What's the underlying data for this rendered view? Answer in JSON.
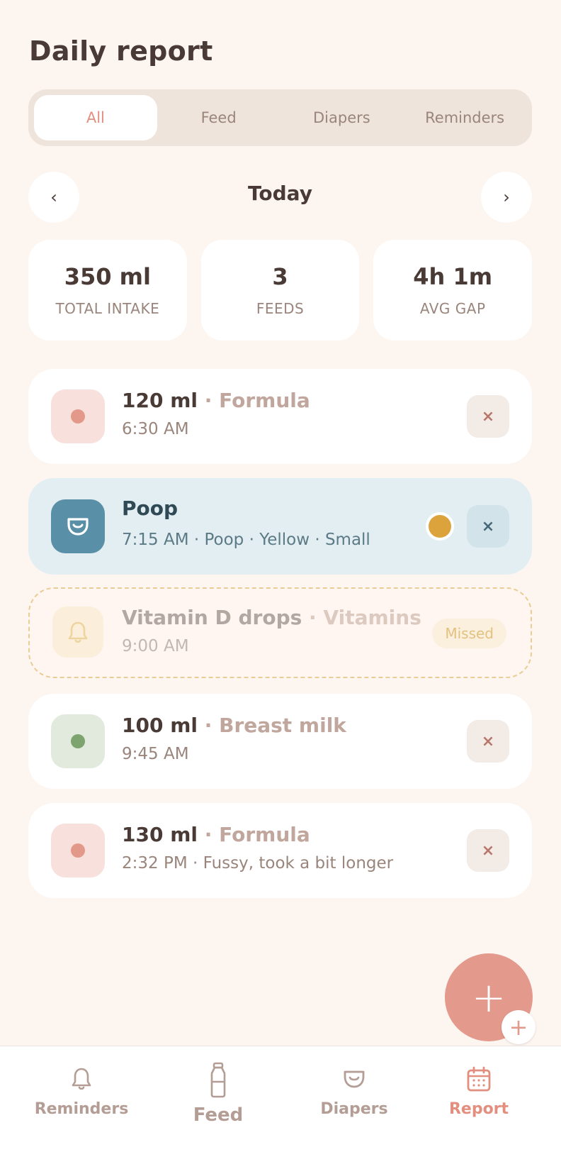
{
  "page": {
    "title": "Daily report"
  },
  "filter_tabs": [
    "All",
    "Feed",
    "Diapers",
    "Reminders"
  ],
  "day_nav": {
    "prev_glyph": "‹",
    "label": "Today",
    "next_glyph": "›"
  },
  "stats": [
    {
      "value": "350 ml",
      "label": "TOTAL INTAKE"
    },
    {
      "value": "3",
      "label": "FEEDS"
    },
    {
      "value": "4h 1m",
      "label": "AVG GAP"
    }
  ],
  "entries": [
    {
      "amount": "120 ml",
      "type": " · Formula",
      "detail": "6:30 AM",
      "dot_color": "#e3998a",
      "thumb_bg": "#f8e1dc"
    },
    {
      "title": "Poop",
      "detail": "7:15 AM · Poop · Yellow · Small",
      "swatch_color": "#dca33c",
      "icon": "diaper-icon"
    },
    {
      "title": "Vitamin D drops",
      "type": " · Vitamins",
      "detail": "9:00 AM",
      "status": "Missed",
      "icon": "bell-icon"
    },
    {
      "amount": "100 ml",
      "type": " · Breast milk",
      "detail": "9:45 AM",
      "dot_color": "#7da36f",
      "thumb_bg": "#e1eadc"
    },
    {
      "amount": "130 ml",
      "type": " · Formula",
      "detail": "2:32 PM · Fussy, took a bit longer",
      "dot_color": "#e3998a",
      "thumb_bg": "#f8e1dc"
    }
  ],
  "delete_glyph": "×",
  "fab": {
    "glyph": "+",
    "mini_glyph": "+"
  },
  "bottom_tabs": [
    {
      "label": "Reminders",
      "icon": "bell-icon"
    },
    {
      "label": "Feed",
      "icon": "bottle-icon"
    },
    {
      "label": "Diapers",
      "icon": "diaper-icon"
    },
    {
      "label": "Report",
      "icon": "calendar-icon",
      "active": true
    }
  ],
  "colors": {
    "accent": "#e38f80",
    "background": "#fdf5f0",
    "diaper_blue": "#5a8fa8"
  }
}
